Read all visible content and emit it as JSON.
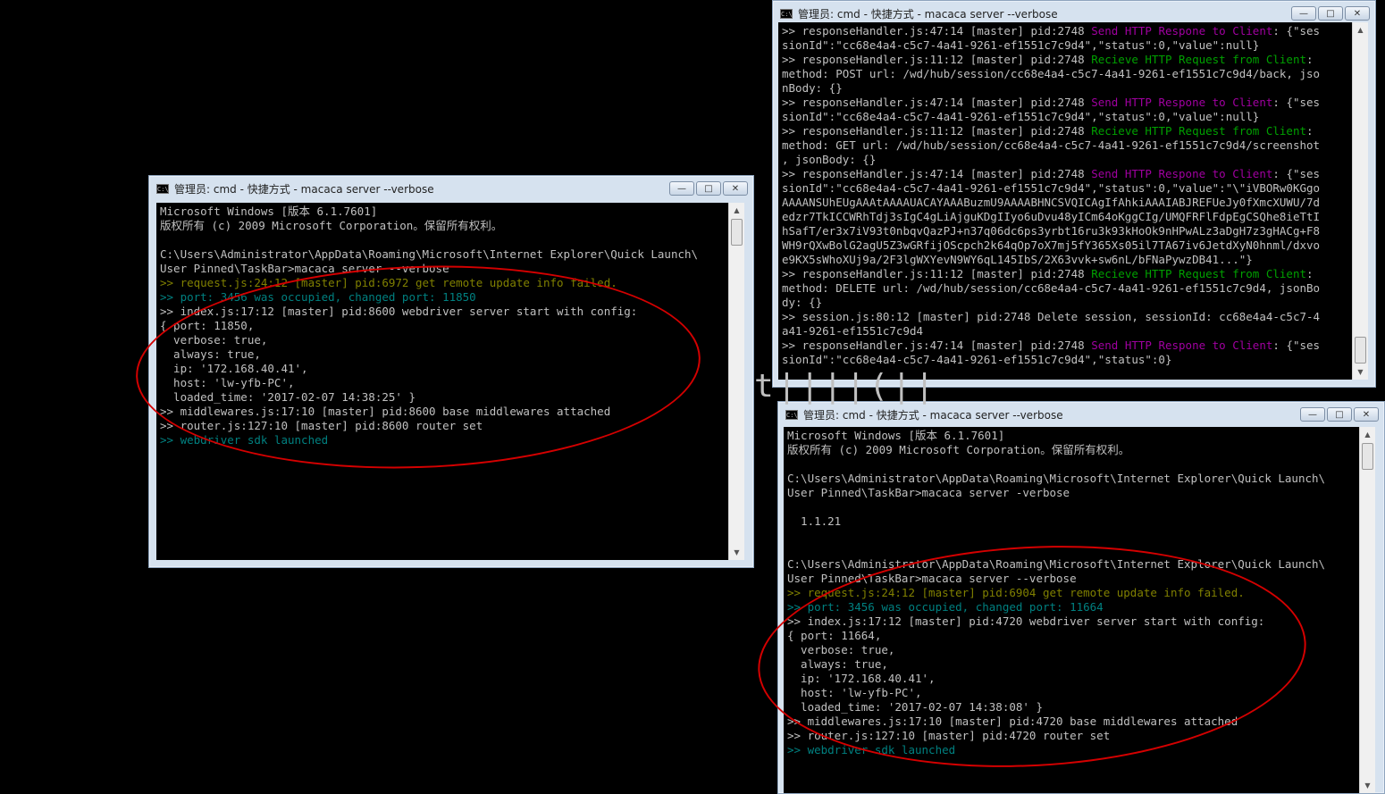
{
  "windows": {
    "left": {
      "title": "管理员: cmd - 快捷方式 - macaca  server --verbose",
      "lines": [
        {
          "text": "Microsoft Windows [版本 6.1.7601]",
          "color": "default"
        },
        {
          "text": "版权所有 (c) 2009 Microsoft Corporation。保留所有权利。",
          "color": "default"
        },
        {
          "text": "",
          "color": "default"
        },
        {
          "text": "C:\\Users\\Administrator\\AppData\\Roaming\\Microsoft\\Internet Explorer\\Quick Launch\\",
          "color": "default"
        },
        {
          "text": "User Pinned\\TaskBar>macaca server --verbose",
          "color": "default"
        },
        {
          "text": ">> request.js:24:12 [master] pid:6972 get remote update info failed.",
          "color": "yellow"
        },
        {
          "text": ">> port: 3456 was occupied, changed port: 11850",
          "color": "teal"
        },
        {
          "text": ">> index.js:17:12 [master] pid:8600 webdriver server start with config:",
          "color": "default"
        },
        {
          "text": "{ port: 11850,",
          "color": "default"
        },
        {
          "text": "  verbose: true,",
          "color": "default"
        },
        {
          "text": "  always: true,",
          "color": "default"
        },
        {
          "text": "  ip: '172.168.40.41',",
          "color": "default"
        },
        {
          "text": "  host: 'lw-yfb-PC',",
          "color": "default"
        },
        {
          "text": "  loaded_time: '2017-02-07 14:38:25' }",
          "color": "default"
        },
        {
          "text": ">> middlewares.js:17:10 [master] pid:8600 base middlewares attached",
          "color": "default"
        },
        {
          "text": ">> router.js:127:10 [master] pid:8600 router set",
          "color": "default"
        },
        {
          "text": ">> webdriver sdk launched",
          "color": "teal"
        }
      ]
    },
    "topright": {
      "title": "管理员: cmd - 快捷方式 - macaca  server --verbose",
      "lines": [
        {
          "parts": [
            [
              ">> responseHandler.js:47:14 [master] pid:2748 ",
              "default"
            ],
            [
              "Send HTTP Respone to Client",
              "purple"
            ],
            [
              ": {\"ses",
              "default"
            ]
          ]
        },
        {
          "parts": [
            [
              "sionId\":\"cc68e4a4-c5c7-4a41-9261-ef1551c7c9d4\",\"status\":0,\"value\":null}",
              "default"
            ]
          ]
        },
        {
          "parts": [
            [
              ">> responseHandler.js:11:12 [master] pid:2748 ",
              "default"
            ],
            [
              "Recieve HTTP Request from Client",
              "green"
            ],
            [
              ":",
              "default"
            ]
          ]
        },
        {
          "parts": [
            [
              "method: POST url: /wd/hub/session/cc68e4a4-c5c7-4a41-9261-ef1551c7c9d4/back, jso",
              "default"
            ]
          ]
        },
        {
          "parts": [
            [
              "nBody: {}",
              "default"
            ]
          ]
        },
        {
          "parts": [
            [
              ">> responseHandler.js:47:14 [master] pid:2748 ",
              "default"
            ],
            [
              "Send HTTP Respone to Client",
              "purple"
            ],
            [
              ": {\"ses",
              "default"
            ]
          ]
        },
        {
          "parts": [
            [
              "sionId\":\"cc68e4a4-c5c7-4a41-9261-ef1551c7c9d4\",\"status\":0,\"value\":null}",
              "default"
            ]
          ]
        },
        {
          "parts": [
            [
              ">> responseHandler.js:11:12 [master] pid:2748 ",
              "default"
            ],
            [
              "Recieve HTTP Request from Client",
              "green"
            ],
            [
              ":",
              "default"
            ]
          ]
        },
        {
          "parts": [
            [
              "method: GET url: /wd/hub/session/cc68e4a4-c5c7-4a41-9261-ef1551c7c9d4/screenshot",
              "default"
            ]
          ]
        },
        {
          "parts": [
            [
              ", jsonBody: {}",
              "default"
            ]
          ]
        },
        {
          "parts": [
            [
              ">> responseHandler.js:47:14 [master] pid:2748 ",
              "default"
            ],
            [
              "Send HTTP Respone to Client",
              "purple"
            ],
            [
              ": {\"ses",
              "default"
            ]
          ]
        },
        {
          "parts": [
            [
              "sionId\":\"cc68e4a4-c5c7-4a41-9261-ef1551c7c9d4\",\"status\":0,\"value\":\"\\\"iVBORw0KGgo",
              "default"
            ]
          ]
        },
        {
          "parts": [
            [
              "AAAANSUhEUgAAAtAAAAUACAYAAABuzmU9AAAABHNCSVQICAgIfAhkiAAAIABJREFUeJy0fXmcXUWU/7d",
              "default"
            ]
          ]
        },
        {
          "parts": [
            [
              "edzr7TkICCWRhTdj3sIgC4gLiAjguKDgIIyo6uDvu48yICm64oKggCIg/UMQFRFlFdpEgCSQhe8ieTtI",
              "default"
            ]
          ]
        },
        {
          "parts": [
            [
              "hSafT/er3x7iV93t0nbqvQazPJ+n37q06dc6ps3yrbt16ru3k93kHoOk9nHPwALz3aDgH7z3gHACg+F8",
              "default"
            ]
          ]
        },
        {
          "parts": [
            [
              "WH9rQXwBolG2agU5Z3wGRfijOScpch2k64qOp7oX7mj5fY365Xs05il7TA67iv6JetdXyN0hnml/dxvo",
              "default"
            ]
          ]
        },
        {
          "parts": [
            [
              "e9KX5sWhoXUj9a/2F3lgWXYevN9WY6qL145IbS/2X63vvk+sw6nL/bFNaPywzDB41...\"}",
              "default"
            ]
          ]
        },
        {
          "parts": [
            [
              ">> responseHandler.js:11:12 [master] pid:2748 ",
              "default"
            ],
            [
              "Recieve HTTP Request from Client",
              "green"
            ],
            [
              ":",
              "default"
            ]
          ]
        },
        {
          "parts": [
            [
              "method: DELETE url: /wd/hub/session/cc68e4a4-c5c7-4a41-9261-ef1551c7c9d4, jsonBo",
              "default"
            ]
          ]
        },
        {
          "parts": [
            [
              "dy: {}",
              "default"
            ]
          ]
        },
        {
          "parts": [
            [
              ">> session.js:80:12 [master] pid:2748 Delete session, sessionId: cc68e4a4-c5c7-4",
              "default"
            ]
          ]
        },
        {
          "parts": [
            [
              "a41-9261-ef1551c7c9d4",
              "default"
            ]
          ]
        },
        {
          "parts": [
            [
              ">> responseHandler.js:47:14 [master] pid:2748 ",
              "default"
            ],
            [
              "Send HTTP Respone to Client",
              "purple"
            ],
            [
              ": {\"ses",
              "default"
            ]
          ]
        },
        {
          "parts": [
            [
              "sionId\":\"cc68e4a4-c5c7-4a41-9261-ef1551c7c9d4\",\"status\":0}",
              "default"
            ]
          ]
        }
      ]
    },
    "bottomright": {
      "title": "管理员: cmd - 快捷方式 - macaca  server --verbose",
      "lines": [
        {
          "text": "Microsoft Windows [版本 6.1.7601]",
          "color": "default"
        },
        {
          "text": "版权所有 (c) 2009 Microsoft Corporation。保留所有权利。",
          "color": "default"
        },
        {
          "text": "",
          "color": "default"
        },
        {
          "text": "C:\\Users\\Administrator\\AppData\\Roaming\\Microsoft\\Internet Explorer\\Quick Launch\\",
          "color": "default"
        },
        {
          "text": "User Pinned\\TaskBar>macaca server -verbose",
          "color": "default"
        },
        {
          "text": "",
          "color": "default"
        },
        {
          "text": "  1.1.21",
          "color": "default"
        },
        {
          "text": "",
          "color": "default"
        },
        {
          "text": "",
          "color": "default"
        },
        {
          "text": "C:\\Users\\Administrator\\AppData\\Roaming\\Microsoft\\Internet Explorer\\Quick Launch\\",
          "color": "default"
        },
        {
          "text": "User Pinned\\TaskBar>macaca server --verbose",
          "color": "default"
        },
        {
          "text": ">> request.js:24:12 [master] pid:6904 get remote update info failed.",
          "color": "yellow"
        },
        {
          "text": ">> port: 3456 was occupied, changed port: 11664",
          "color": "teal"
        },
        {
          "text": ">> index.js:17:12 [master] pid:4720 webdriver server start with config:",
          "color": "default"
        },
        {
          "text": "{ port: 11664,",
          "color": "default"
        },
        {
          "text": "  verbose: true,",
          "color": "default"
        },
        {
          "text": "  always: true,",
          "color": "default"
        },
        {
          "text": "  ip: '172.168.40.41',",
          "color": "default"
        },
        {
          "text": "  host: 'lw-yfb-PC',",
          "color": "default"
        },
        {
          "text": "  loaded_time: '2017-02-07 14:38:08' }",
          "color": "default"
        },
        {
          "text": ">> middlewares.js:17:10 [master] pid:4720 base middlewares attached",
          "color": "default"
        },
        {
          "text": ">> router.js:127:10 [master] pid:4720 router set",
          "color": "default"
        },
        {
          "text": ">> webdriver sdk launched",
          "color": "teal"
        }
      ]
    }
  },
  "window_controls": {
    "minimize": "—",
    "maximize": "□",
    "close": "✕"
  },
  "scroll_arrows": {
    "up": "▲",
    "down": "▼"
  },
  "artifact_text": "t||||(||",
  "colors": {
    "annotation": "#d40000",
    "console_text": "#c0c0c0",
    "yellow": "#808000",
    "teal": "#008080",
    "green": "#00a000",
    "purple": "#a000a0"
  }
}
